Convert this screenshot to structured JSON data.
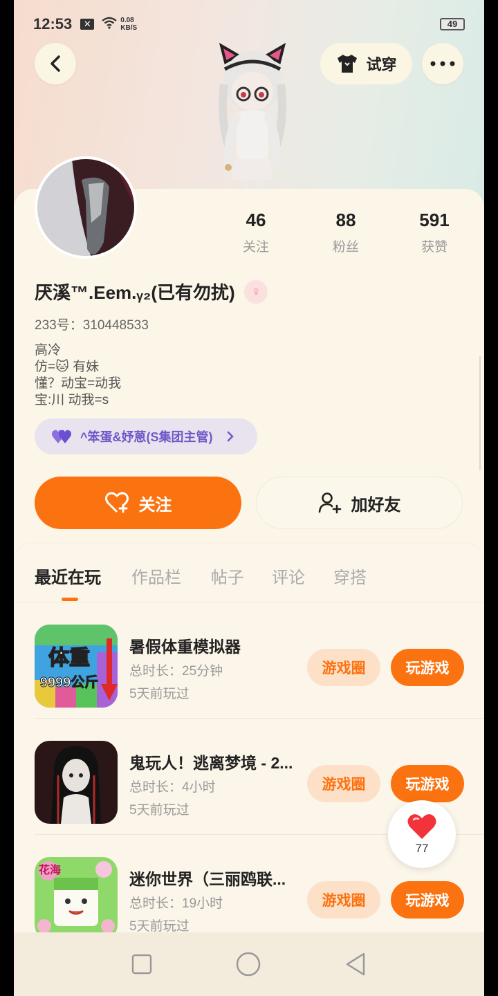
{
  "status_bar": {
    "time": "12:53",
    "net_speed_value": "0.08",
    "net_speed_unit": "KB/S",
    "battery": "49"
  },
  "header": {
    "tryon_label": "试穿"
  },
  "stats": [
    {
      "value": "46",
      "label": "关注"
    },
    {
      "value": "88",
      "label": "粉丝"
    },
    {
      "value": "591",
      "label": "获赞"
    }
  ],
  "profile": {
    "name": "厌溪™.Eem.ᵧ₂(已有勿扰)",
    "uid": "233号：310448533",
    "bio": [
      "高冷",
      "仿=🐱 有妹",
      "懂？动宝=动我",
      "宝:川 动我=s"
    ]
  },
  "group": {
    "label": "^笨蛋&妤蒽(S集团主管)"
  },
  "actions": {
    "follow_label": "关注",
    "add_friend_label": "加好友"
  },
  "tabs": [
    "最近在玩",
    "作品栏",
    "帖子",
    "评论",
    "穿搭"
  ],
  "games": [
    {
      "title": "暑假体重模拟器",
      "duration": "总时长：25分钟",
      "last_played": "5天前玩过",
      "circle_label": "游戏圈",
      "play_label": "玩游戏",
      "icon_text_1": "体重",
      "icon_text_2": "9999公斤"
    },
    {
      "title": "鬼玩人！逃离梦境 - 2...",
      "duration": "总时长：4小时",
      "last_played": "5天前玩过",
      "circle_label": "游戏圈",
      "play_label": "玩游戏"
    },
    {
      "title": "迷你世界（三丽鸥联...",
      "duration": "总时长：19小时",
      "last_played": "5天前玩过",
      "circle_label": "游戏圈",
      "play_label": "玩游戏",
      "icon_text_1": "花海"
    }
  ],
  "like_fab": {
    "count": "77"
  },
  "colors": {
    "accent": "#fb7310",
    "accent_light": "#fde0c8",
    "background": "#fcf6ea",
    "group_purple": "#7058c8"
  }
}
